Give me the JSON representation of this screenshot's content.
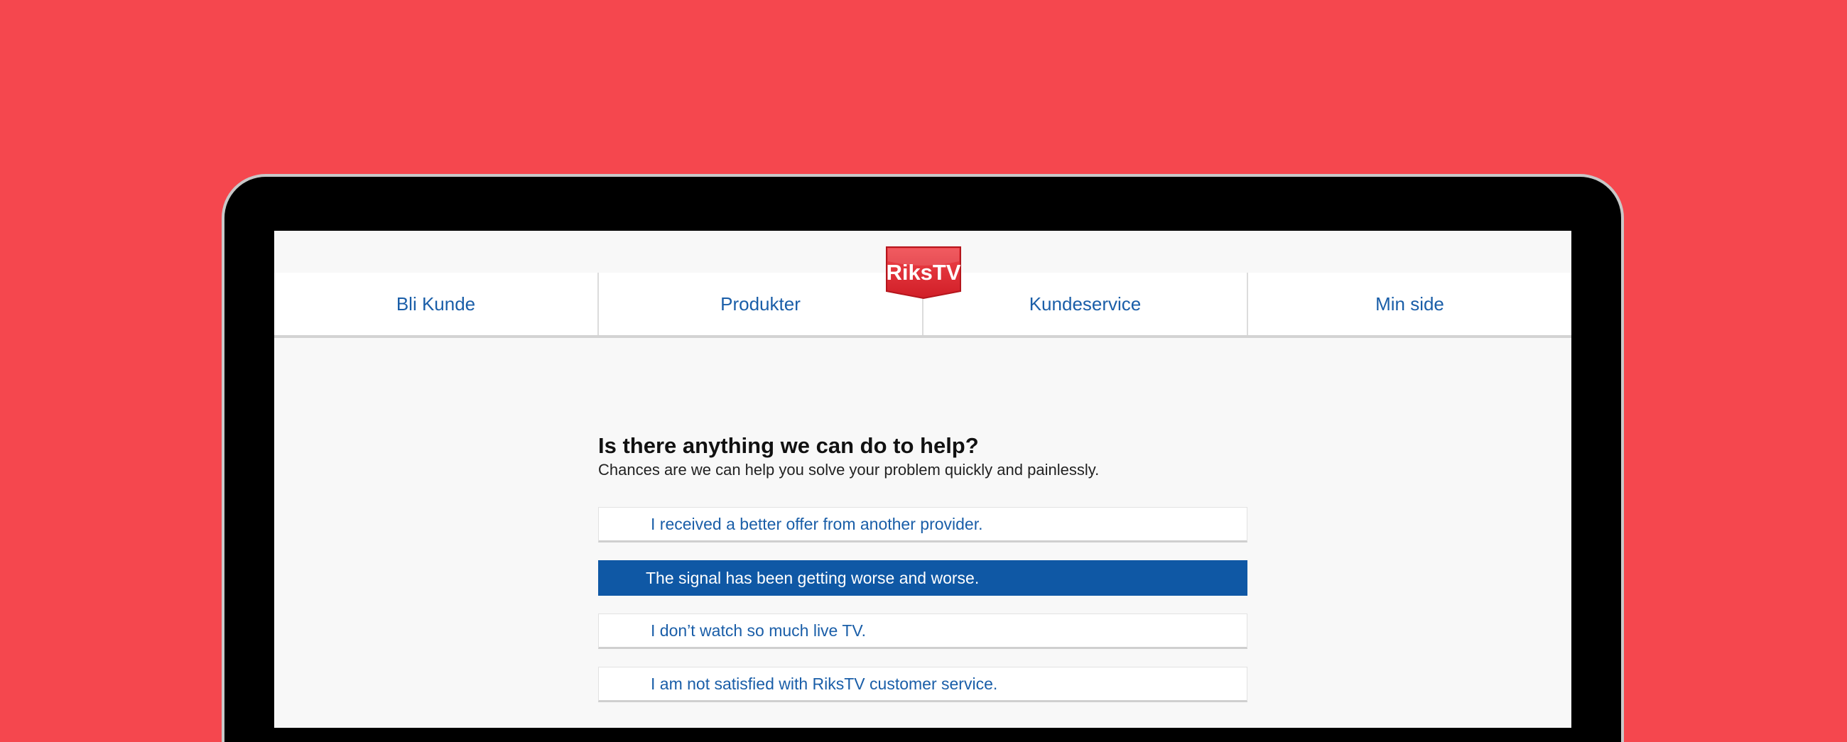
{
  "brand": {
    "logo_text": "RiksTV",
    "logo_color": "#e3262e"
  },
  "colors": {
    "background": "#f5474e",
    "link": "#1a5ea8",
    "selected": "#0f58a5"
  },
  "nav": {
    "items": [
      {
        "label": "Bli Kunde"
      },
      {
        "label": "Produkter"
      },
      {
        "label": "Kundeservice"
      },
      {
        "label": "Min side"
      }
    ]
  },
  "main": {
    "title": "Is there anything we can do to help?",
    "subtitle": "Chances are we can help you solve your problem quickly and painlessly.",
    "options": [
      {
        "label": "I received a better offer from another provider.",
        "selected": false
      },
      {
        "label": "The signal has been getting worse and worse.",
        "selected": true
      },
      {
        "label": "I don’t watch so much live TV.",
        "selected": false
      },
      {
        "label": "I am not satisfied with RiksTV customer service.",
        "selected": false
      }
    ]
  }
}
